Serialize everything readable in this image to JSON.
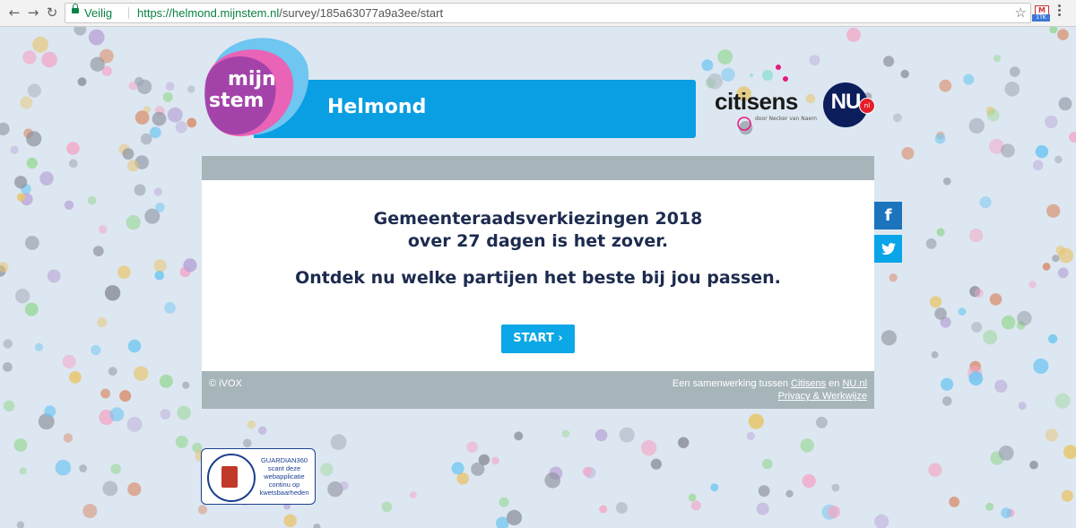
{
  "browser": {
    "secure_label": "Veilig",
    "url_host": "https://helmond.mijnstem.nl",
    "url_path": "/survey/185a63077a9a3ee/start",
    "ext_badge": "1TK"
  },
  "header": {
    "logo_line1": "mijn",
    "logo_line2": "stem",
    "city": "Helmond",
    "partner1_name": "citisens",
    "partner1_tagline": "door Necker van Naem",
    "partner2_name": "NU",
    "partner2_suffix": "nl"
  },
  "main": {
    "heading_line1": "Gemeenteraadsverkiezingen 2018",
    "heading_line2": "over 27 dagen is het zover.",
    "subheading": "Ontdek nu welke partijen het beste bij jou passen.",
    "start_label": "START ›"
  },
  "footer": {
    "copyright": "© iVOX",
    "collab_prefix": "Een samenwerking tussen ",
    "collab_link1": "Citisens",
    "collab_and": " en ",
    "collab_link2": "NU.nl",
    "privacy_link": "Privacy & Werkwijze"
  },
  "social": {
    "facebook": "f",
    "twitter": "🐦"
  },
  "badge": {
    "text": "GUARDIAN360 scant deze webapplicatie continu op kwetsbaarheden"
  },
  "colors": {
    "banner": "#0a9ee2",
    "card_band": "#a7b5bb",
    "heading": "#1d2b4f",
    "button": "#0ba7e6"
  }
}
